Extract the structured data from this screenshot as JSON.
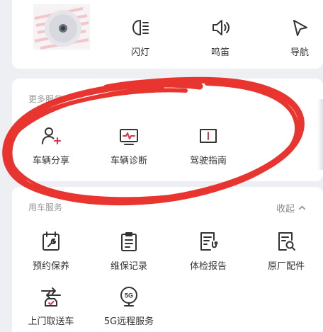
{
  "top_actions": [
    {
      "label": "闪灯",
      "icon": "headlight-icon"
    },
    {
      "label": "鸣笛",
      "icon": "horn-speaker-icon"
    },
    {
      "label": "导航",
      "icon": "navigation-arrow-icon"
    }
  ],
  "more_services": {
    "title": "更多服务",
    "items": [
      {
        "label": "车辆分享",
        "icon": "user-add-icon"
      },
      {
        "label": "车辆诊断",
        "icon": "diagnosis-monitor-icon"
      },
      {
        "label": "驾驶指南",
        "icon": "guide-book-icon"
      }
    ]
  },
  "common_services": {
    "title": "用车服务",
    "collapse_label": "收起",
    "items": [
      {
        "label": "预约保养",
        "icon": "calendar-wrench-icon"
      },
      {
        "label": "维保记录",
        "icon": "clipboard-list-icon"
      },
      {
        "label": "体检报告",
        "icon": "report-stethoscope-icon"
      },
      {
        "label": "原厂配件",
        "icon": "document-search-icon"
      },
      {
        "label": "上门取送车",
        "icon": "pickup-delivery-car-icon"
      },
      {
        "label": "5G远程服务",
        "icon": "5g-remote-icon"
      }
    ],
    "badge_5g": "5G"
  },
  "colors": {
    "accent": "#e0344a",
    "scribble": "#e8241e",
    "icon_stroke": "#333333",
    "section_title": "#999999"
  }
}
